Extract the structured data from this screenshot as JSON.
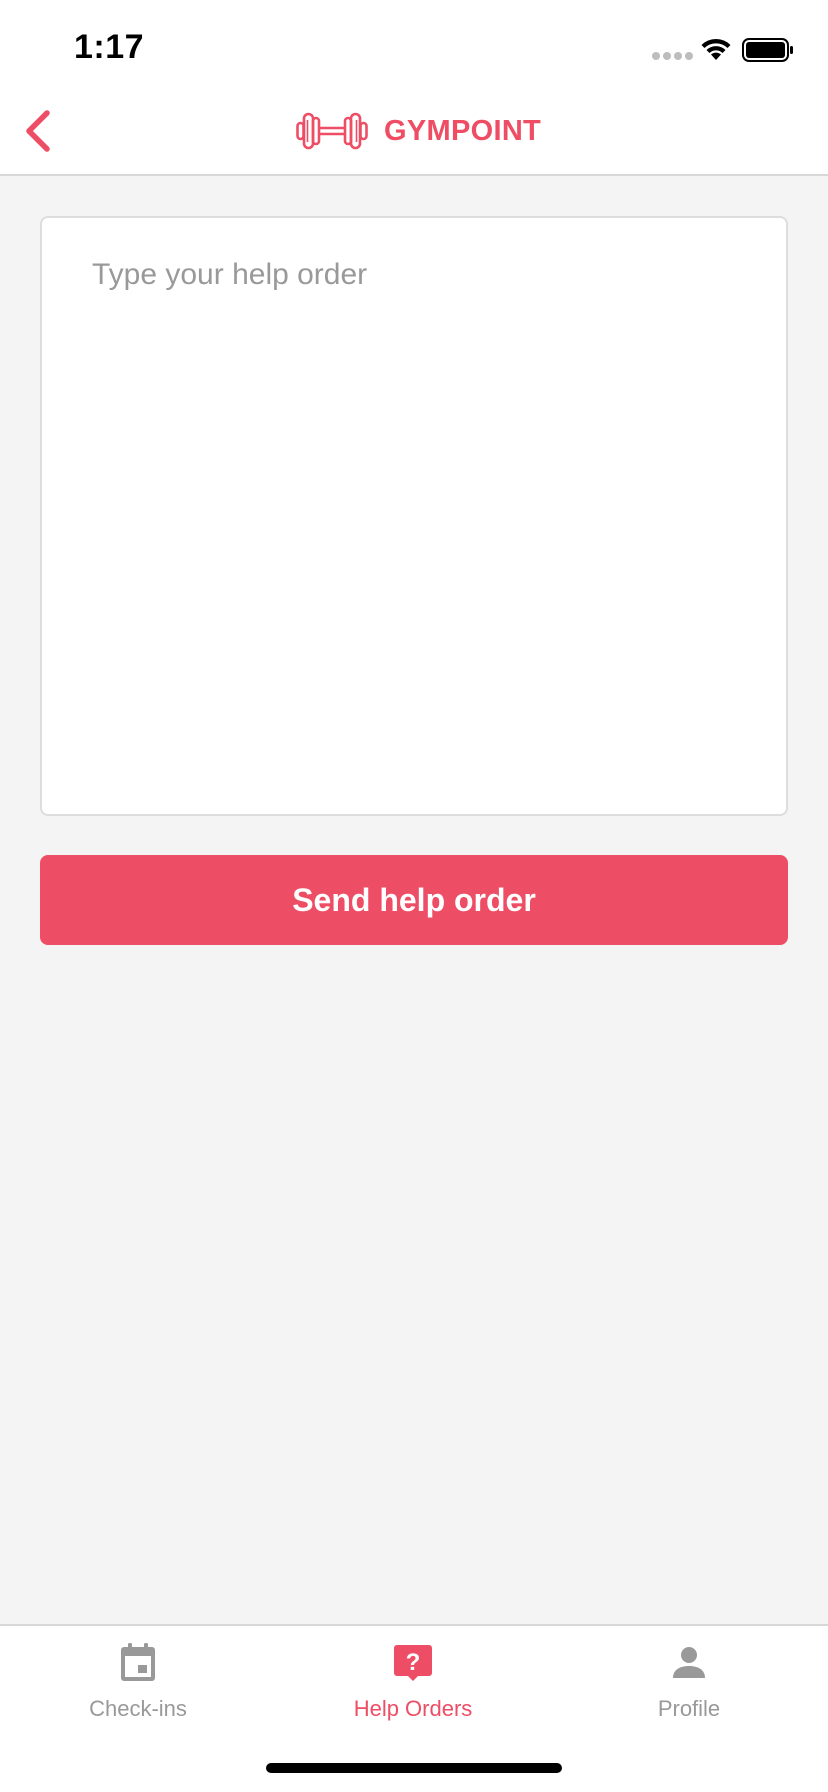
{
  "status_bar": {
    "time": "1:17"
  },
  "header": {
    "brand_name": "GYMPOINT",
    "back_icon": "chevron-left-icon",
    "logo_icon": "dumbbell-icon"
  },
  "form": {
    "textarea_placeholder": "Type your help order",
    "textarea_value": "",
    "send_label": "Send help order"
  },
  "tabs": [
    {
      "label": "Check-ins",
      "icon": "calendar-icon",
      "active": false
    },
    {
      "label": "Help Orders",
      "icon": "help-bubble-icon",
      "active": true
    },
    {
      "label": "Profile",
      "icon": "person-icon",
      "active": false
    }
  ],
  "colors": {
    "accent": "#ee4e65",
    "inactive": "#999999",
    "background": "#f4f4f4"
  }
}
